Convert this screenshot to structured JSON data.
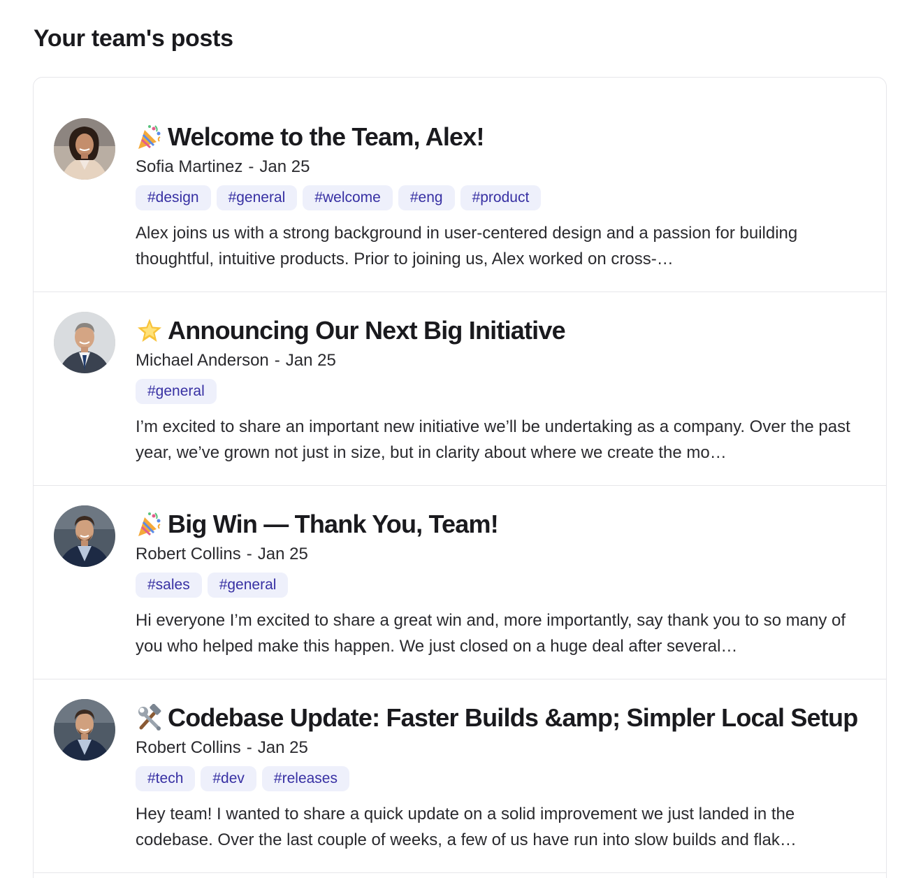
{
  "header": {
    "title": "Your team's posts"
  },
  "posts": [
    {
      "emoji_icon": "party-popper-icon",
      "title": "Welcome to the Team, Alex!",
      "author": "Sofia Martinez",
      "separator": "-",
      "date": "Jan 25",
      "tags": [
        "#design",
        "#general",
        "#welcome",
        "#eng",
        "#product"
      ],
      "excerpt": "Alex joins us with a strong background in user-centered design and a passion for building thoughtful, intuitive products. Prior to joining us, Alex worked on cross-…"
    },
    {
      "emoji_icon": "glowing-star-icon",
      "title": "Announcing Our Next Big Initiative",
      "author": "Michael Anderson",
      "separator": "-",
      "date": "Jan 25",
      "tags": [
        "#general"
      ],
      "excerpt": "I’m excited to share an important new initiative we’ll be undertaking as a company. Over the past year, we’ve grown not just in size, but in clarity about where we create the mo…"
    },
    {
      "emoji_icon": "party-popper-icon",
      "title": "Big Win — Thank You, Team!",
      "author": "Robert Collins",
      "separator": "-",
      "date": "Jan 25",
      "tags": [
        "#sales",
        "#general"
      ],
      "excerpt": "Hi everyone I’m excited to share a great win and, more importantly, say thank you to so many of you who helped make this happen. We just closed on a huge deal after several…"
    },
    {
      "emoji_icon": "hammer-and-wrench-icon",
      "title": "Codebase Update: Faster Builds &amp; Simpler Local Setup",
      "author": "Robert Collins",
      "separator": "-",
      "date": "Jan 25",
      "tags": [
        "#tech",
        "#dev",
        "#releases"
      ],
      "excerpt": "Hey team! I wanted to share a quick update on a solid improvement we just landed in the codebase. Over the last couple of weeks, a few of us have run into slow builds and flak…"
    }
  ]
}
